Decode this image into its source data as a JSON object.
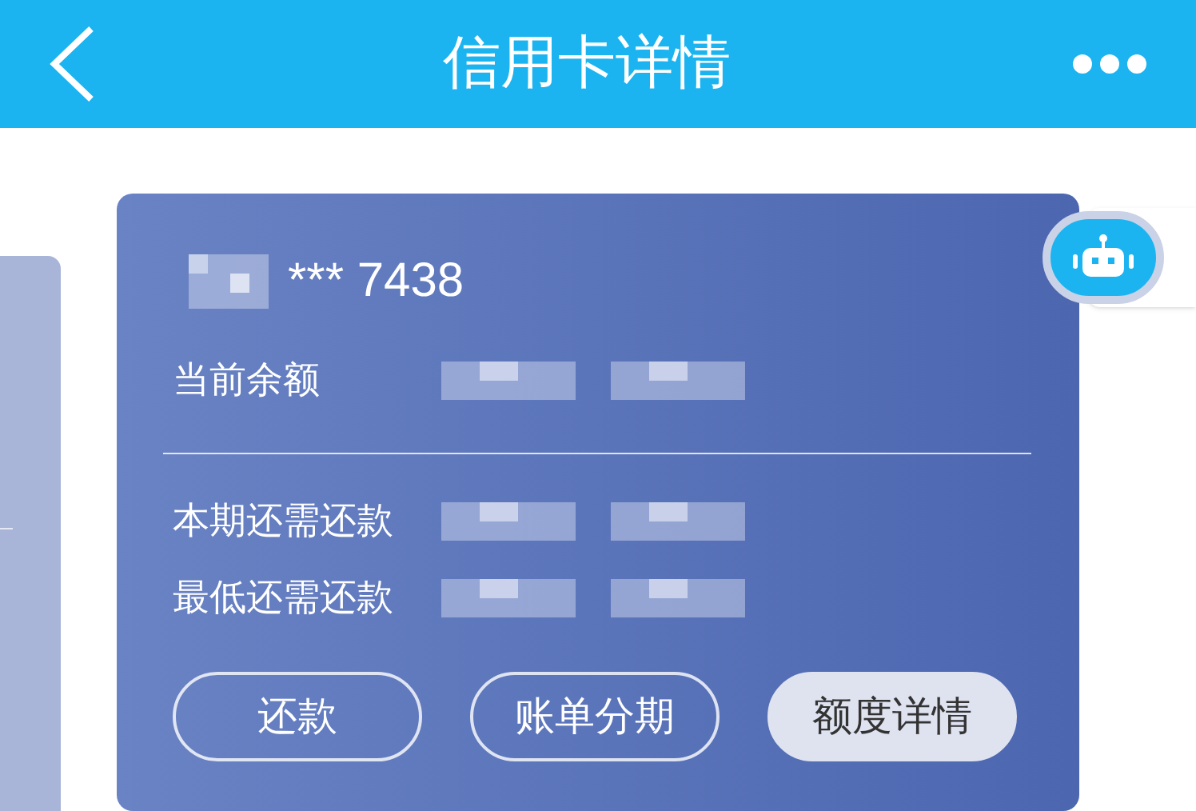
{
  "header": {
    "title": "信用卡详情"
  },
  "card": {
    "number": "*** 7438",
    "rows": [
      {
        "label": "当前余额"
      },
      {
        "label": "本期还需还款"
      },
      {
        "label": "最低还需还款"
      }
    ],
    "buttons": [
      {
        "label": "还款",
        "kind": "outline"
      },
      {
        "label": "账单分期",
        "kind": "outline"
      },
      {
        "label": "额度详情",
        "kind": "filled"
      }
    ]
  }
}
